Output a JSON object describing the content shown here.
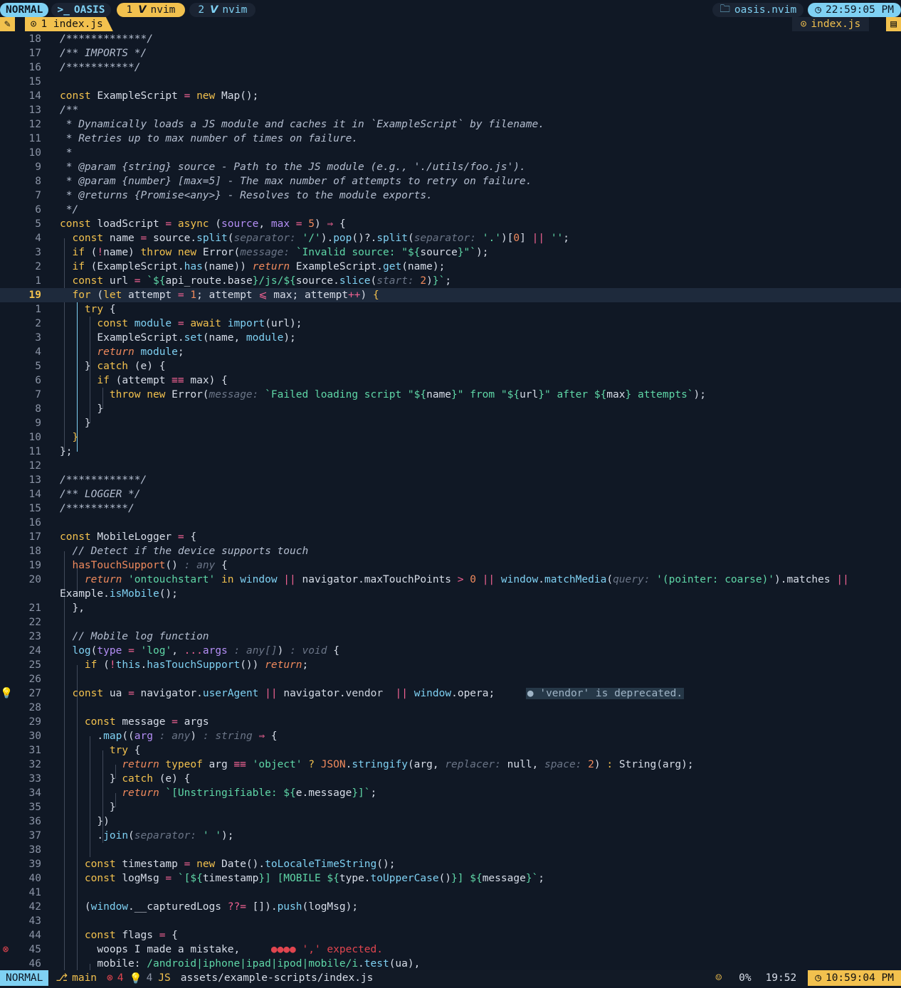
{
  "tabline": {
    "mode": "NORMAL",
    "session": "OASIS",
    "tabs": [
      {
        "num": "1",
        "label": "nvim"
      },
      {
        "num": "2",
        "label": "nvim"
      }
    ],
    "config_file": "oasis.nvim",
    "clock": "22:59:05 PM"
  },
  "winbar": {
    "buffer_label": "1 index.js",
    "active_file": "index.js"
  },
  "statusline": {
    "mode": "NORMAL",
    "branch": "main",
    "errors": "4",
    "hints": "4",
    "file_path": "assets/example-scripts/index.js",
    "progress": "0%",
    "position": "19:52",
    "clock": "10:59:04 PM"
  },
  "editor": {
    "line_numbers": [
      "18",
      "17",
      "16",
      "15",
      "14",
      "13",
      "12",
      "11",
      "10",
      "9",
      "8",
      "7",
      "6",
      "5",
      "4",
      "3",
      "2",
      "1",
      "19",
      "1",
      "2",
      "3",
      "4",
      "5",
      "6",
      "7",
      "8",
      "9",
      "10",
      "11",
      "12",
      "13",
      "14",
      "15",
      "16",
      "17",
      "18",
      "19",
      "20",
      "",
      "21",
      "22",
      "23",
      "24",
      "25",
      "26",
      "27",
      "28",
      "29",
      "30",
      "31",
      "32",
      "33",
      "34",
      "35",
      "36",
      "37",
      "38",
      "39",
      "40",
      "41",
      "42",
      "43",
      "44",
      "45",
      "46"
    ],
    "current_line": "19",
    "inline_diagnostics": {
      "deprecated": "● 'vendor' is deprecated.",
      "error": "●●●● ',' expected."
    }
  }
}
